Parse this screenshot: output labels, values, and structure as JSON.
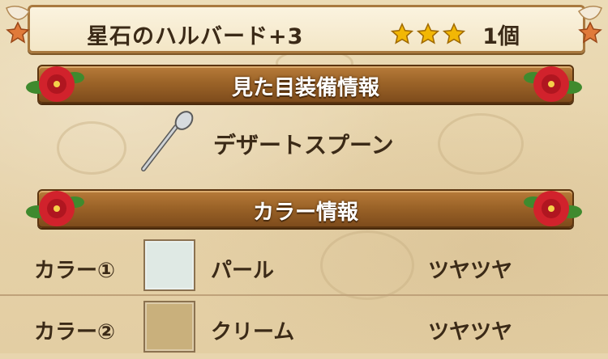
{
  "item": {
    "name": "星石のハルバード+3",
    "stars": 3,
    "count": "1個"
  },
  "appearance_section": {
    "title": "見た目装備情報",
    "item_label": "デザートスプーン",
    "icon": "spoon-icon"
  },
  "color_section": {
    "title": "カラー情報",
    "rows": [
      {
        "label": "カラー①",
        "swatch_color": "#dfe9e4",
        "name": "パール",
        "finish": "ツヤツヤ"
      },
      {
        "label": "カラー②",
        "swatch_color": "#c9b07c",
        "name": "クリーム",
        "finish": "ツヤツヤ"
      }
    ]
  },
  "colors": {
    "banner": "#9c6428",
    "text": "#3b2a17",
    "star": "#f2b705",
    "parchment": "#e6d2a9"
  }
}
